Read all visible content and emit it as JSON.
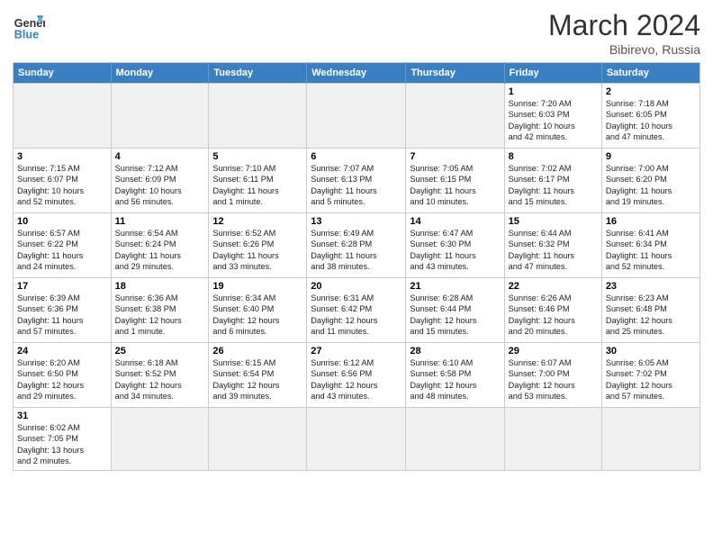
{
  "header": {
    "logo_general": "General",
    "logo_blue": "Blue",
    "month_year": "March 2024",
    "location": "Bibirevo, Russia"
  },
  "days_of_week": [
    "Sunday",
    "Monday",
    "Tuesday",
    "Wednesday",
    "Thursday",
    "Friday",
    "Saturday"
  ],
  "weeks": [
    [
      {
        "num": "",
        "info": ""
      },
      {
        "num": "",
        "info": ""
      },
      {
        "num": "",
        "info": ""
      },
      {
        "num": "",
        "info": ""
      },
      {
        "num": "",
        "info": ""
      },
      {
        "num": "1",
        "info": "Sunrise: 7:20 AM\nSunset: 6:03 PM\nDaylight: 10 hours\nand 42 minutes."
      },
      {
        "num": "2",
        "info": "Sunrise: 7:18 AM\nSunset: 6:05 PM\nDaylight: 10 hours\nand 47 minutes."
      }
    ],
    [
      {
        "num": "3",
        "info": "Sunrise: 7:15 AM\nSunset: 6:07 PM\nDaylight: 10 hours\nand 52 minutes."
      },
      {
        "num": "4",
        "info": "Sunrise: 7:12 AM\nSunset: 6:09 PM\nDaylight: 10 hours\nand 56 minutes."
      },
      {
        "num": "5",
        "info": "Sunrise: 7:10 AM\nSunset: 6:11 PM\nDaylight: 11 hours\nand 1 minute."
      },
      {
        "num": "6",
        "info": "Sunrise: 7:07 AM\nSunset: 6:13 PM\nDaylight: 11 hours\nand 5 minutes."
      },
      {
        "num": "7",
        "info": "Sunrise: 7:05 AM\nSunset: 6:15 PM\nDaylight: 11 hours\nand 10 minutes."
      },
      {
        "num": "8",
        "info": "Sunrise: 7:02 AM\nSunset: 6:17 PM\nDaylight: 11 hours\nand 15 minutes."
      },
      {
        "num": "9",
        "info": "Sunrise: 7:00 AM\nSunset: 6:20 PM\nDaylight: 11 hours\nand 19 minutes."
      }
    ],
    [
      {
        "num": "10",
        "info": "Sunrise: 6:57 AM\nSunset: 6:22 PM\nDaylight: 11 hours\nand 24 minutes."
      },
      {
        "num": "11",
        "info": "Sunrise: 6:54 AM\nSunset: 6:24 PM\nDaylight: 11 hours\nand 29 minutes."
      },
      {
        "num": "12",
        "info": "Sunrise: 6:52 AM\nSunset: 6:26 PM\nDaylight: 11 hours\nand 33 minutes."
      },
      {
        "num": "13",
        "info": "Sunrise: 6:49 AM\nSunset: 6:28 PM\nDaylight: 11 hours\nand 38 minutes."
      },
      {
        "num": "14",
        "info": "Sunrise: 6:47 AM\nSunset: 6:30 PM\nDaylight: 11 hours\nand 43 minutes."
      },
      {
        "num": "15",
        "info": "Sunrise: 6:44 AM\nSunset: 6:32 PM\nDaylight: 11 hours\nand 47 minutes."
      },
      {
        "num": "16",
        "info": "Sunrise: 6:41 AM\nSunset: 6:34 PM\nDaylight: 11 hours\nand 52 minutes."
      }
    ],
    [
      {
        "num": "17",
        "info": "Sunrise: 6:39 AM\nSunset: 6:36 PM\nDaylight: 11 hours\nand 57 minutes."
      },
      {
        "num": "18",
        "info": "Sunrise: 6:36 AM\nSunset: 6:38 PM\nDaylight: 12 hours\nand 1 minute."
      },
      {
        "num": "19",
        "info": "Sunrise: 6:34 AM\nSunset: 6:40 PM\nDaylight: 12 hours\nand 6 minutes."
      },
      {
        "num": "20",
        "info": "Sunrise: 6:31 AM\nSunset: 6:42 PM\nDaylight: 12 hours\nand 11 minutes."
      },
      {
        "num": "21",
        "info": "Sunrise: 6:28 AM\nSunset: 6:44 PM\nDaylight: 12 hours\nand 15 minutes."
      },
      {
        "num": "22",
        "info": "Sunrise: 6:26 AM\nSunset: 6:46 PM\nDaylight: 12 hours\nand 20 minutes."
      },
      {
        "num": "23",
        "info": "Sunrise: 6:23 AM\nSunset: 6:48 PM\nDaylight: 12 hours\nand 25 minutes."
      }
    ],
    [
      {
        "num": "24",
        "info": "Sunrise: 6:20 AM\nSunset: 6:50 PM\nDaylight: 12 hours\nand 29 minutes."
      },
      {
        "num": "25",
        "info": "Sunrise: 6:18 AM\nSunset: 6:52 PM\nDaylight: 12 hours\nand 34 minutes."
      },
      {
        "num": "26",
        "info": "Sunrise: 6:15 AM\nSunset: 6:54 PM\nDaylight: 12 hours\nand 39 minutes."
      },
      {
        "num": "27",
        "info": "Sunrise: 6:12 AM\nSunset: 6:56 PM\nDaylight: 12 hours\nand 43 minutes."
      },
      {
        "num": "28",
        "info": "Sunrise: 6:10 AM\nSunset: 6:58 PM\nDaylight: 12 hours\nand 48 minutes."
      },
      {
        "num": "29",
        "info": "Sunrise: 6:07 AM\nSunset: 7:00 PM\nDaylight: 12 hours\nand 53 minutes."
      },
      {
        "num": "30",
        "info": "Sunrise: 6:05 AM\nSunset: 7:02 PM\nDaylight: 12 hours\nand 57 minutes."
      }
    ],
    [
      {
        "num": "31",
        "info": "Sunrise: 6:02 AM\nSunset: 7:05 PM\nDaylight: 13 hours\nand 2 minutes."
      },
      {
        "num": "",
        "info": ""
      },
      {
        "num": "",
        "info": ""
      },
      {
        "num": "",
        "info": ""
      },
      {
        "num": "",
        "info": ""
      },
      {
        "num": "",
        "info": ""
      },
      {
        "num": "",
        "info": ""
      }
    ]
  ]
}
